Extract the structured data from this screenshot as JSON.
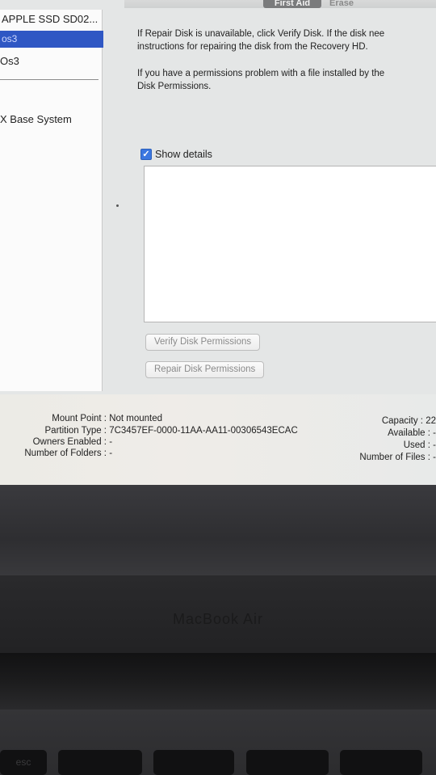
{
  "window": {
    "tabs": {
      "first_aid": "First Aid",
      "erase": "Erase"
    }
  },
  "sidebar": {
    "disk": "APPLE SSD SD02...",
    "selected_volume": "os3",
    "volume": "Os3",
    "base_system": "X Base System"
  },
  "first_aid": {
    "info_line_1a": "If Repair Disk is unavailable, click Verify Disk. If the disk nee",
    "info_line_1b": "instructions for repairing the disk from the Recovery HD.",
    "info_line_2a": "If you have a permissions problem with a file installed by the",
    "info_line_2b": "Disk Permissions.",
    "show_details_label": "Show details",
    "show_details_checked": true,
    "verify_permissions_button": "Verify Disk Permissions",
    "repair_permissions_button": "Repair Disk Permissions"
  },
  "disk_info": {
    "mount_point_label": "Mount Point :",
    "mount_point_value": "Not mounted",
    "partition_type_label": "Partition Type :",
    "partition_type_value": "7C3457EF-0000-11AA-AA11-00306543ECAC",
    "owners_enabled_label": "Owners Enabled :",
    "owners_enabled_value": "-",
    "number_of_folders_label": "Number of Folders :",
    "number_of_folders_value": "-",
    "capacity_label": "Capacity :",
    "capacity_value": "22",
    "available_label": "Available :",
    "available_value": "-",
    "used_label": "Used :",
    "used_value": "-",
    "number_of_files_label": "Number of Files :",
    "number_of_files_value": "-"
  },
  "laptop": {
    "brand": "MacBook Air",
    "key_esc": "esc"
  },
  "colors": {
    "selection_blue": "#2f57c4",
    "checkbox_blue": "#3b77e0"
  }
}
